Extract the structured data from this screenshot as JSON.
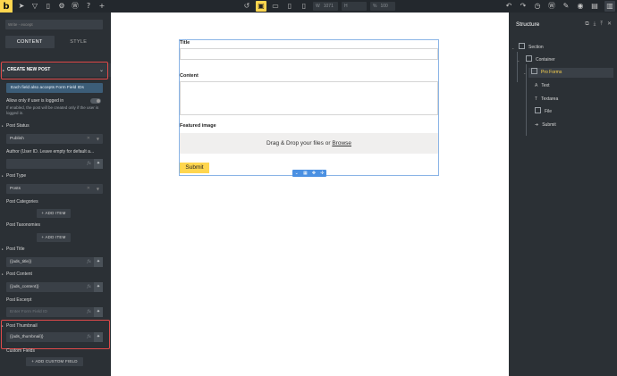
{
  "toolbar": {
    "logo": "b",
    "width_label": "W",
    "width_value": "1071",
    "height_label": "H",
    "height_value": "",
    "zoom_label": "%",
    "zoom_value": "100"
  },
  "left": {
    "search_placeholder": "Write - except",
    "tabs": [
      {
        "label": "CONTENT"
      },
      {
        "label": "STYLE"
      }
    ],
    "section_title": "CREATE NEW POST",
    "info": "Each field also accepts Form Field IDs",
    "allow_label": "Allow only if user is logged in",
    "allow_note": "If enabled, the post will be created only if the user is logged in.",
    "post_status_label": "Post Status",
    "post_status_value": "Publish",
    "author_label": "Author (User ID. Leave empty for default a...",
    "post_type_label": "Post Type",
    "post_type_value": "Posts",
    "post_categories_label": "Post Categories",
    "add_item": "+ ADD ITEM",
    "post_taxonomies_label": "Post Taxonomies",
    "post_title_label": "Post Title",
    "post_title_value": "{{ads_title}}",
    "post_content_label": "Post Content",
    "post_content_value": "{{ads_content}}",
    "post_excerpt_label": "Post Excerpt",
    "post_excerpt_placeholder": "Enter Form Field ID",
    "post_thumbnail_label": "Post Thumbnail",
    "post_thumbnail_value": "{{ads_thumbnail}}",
    "custom_fields_label": "Custom Fields",
    "add_custom_field": "+ ADD CUSTOM FIELD",
    "fx": "fx"
  },
  "form": {
    "title_label": "Title",
    "content_label": "Content",
    "featured_label": "Featured image",
    "drop_text": "Drag & Drop your files or ",
    "drop_link": "Browse",
    "submit_label": "Submit"
  },
  "structure": {
    "title": "Structure",
    "items": [
      {
        "label": "Section"
      },
      {
        "label": "Container"
      },
      {
        "label": "Pro Forms"
      },
      {
        "label": "Text"
      },
      {
        "label": "Textarea"
      },
      {
        "label": "File"
      },
      {
        "label": "Submit"
      }
    ]
  },
  "colors": {
    "accent": "#ffd64f",
    "highlight": "#e04a4a",
    "info_bg": "#3c5d78",
    "panel_bg": "#2b3035"
  }
}
